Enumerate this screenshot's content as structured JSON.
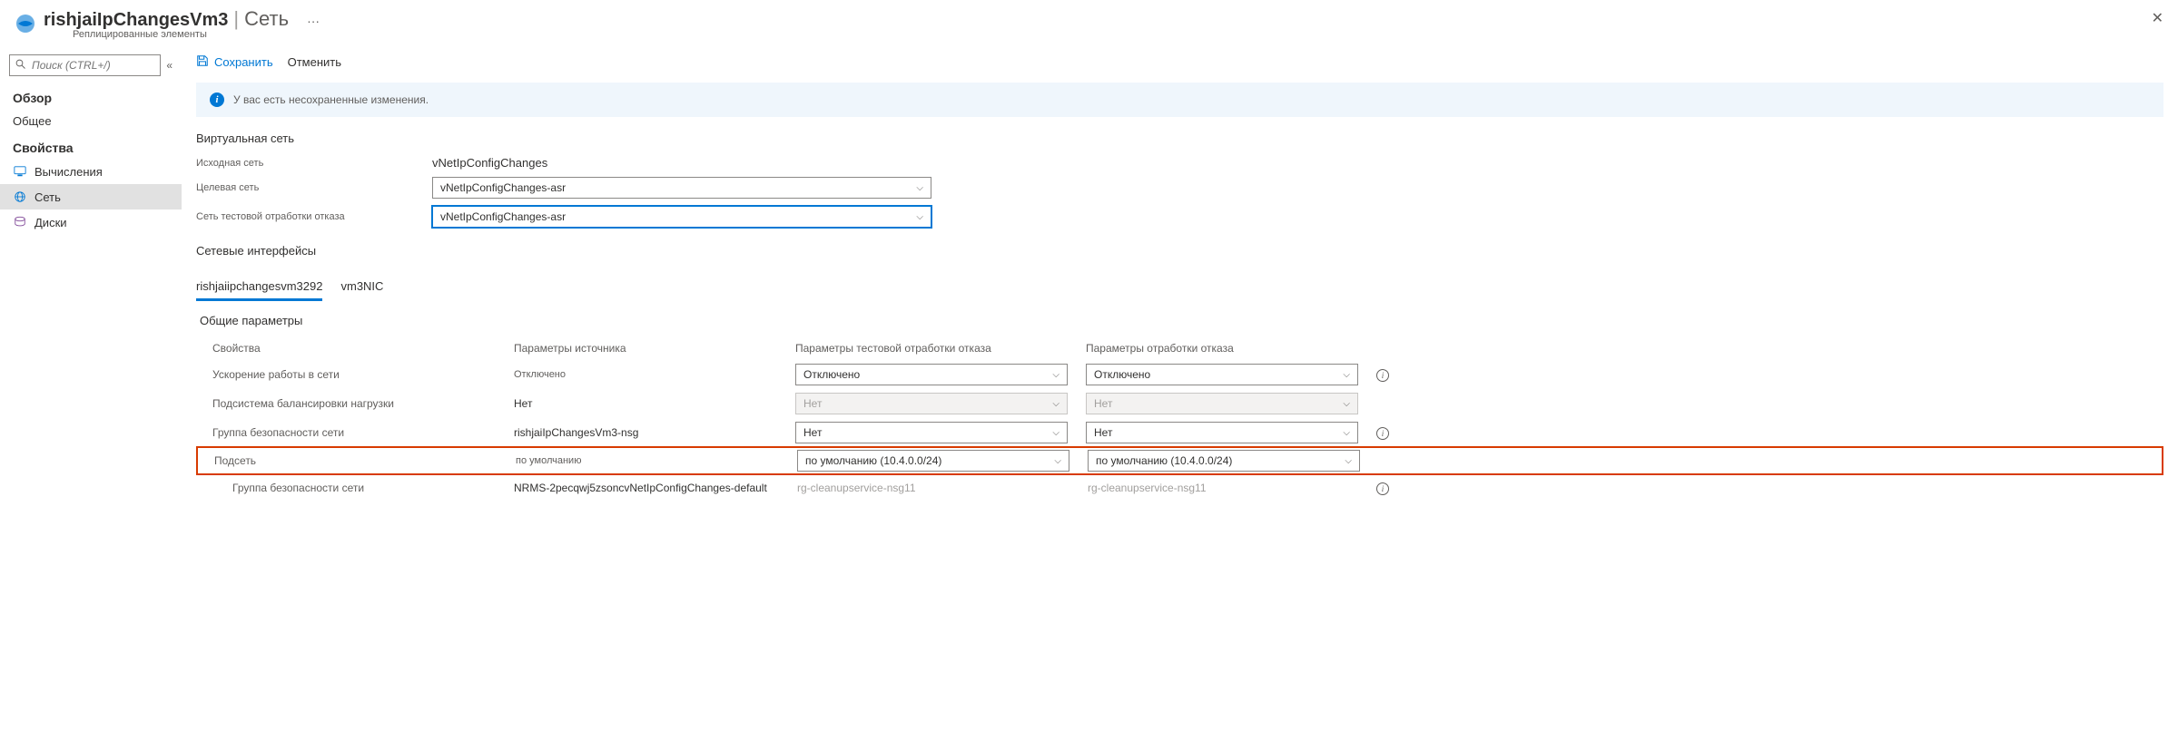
{
  "header": {
    "resource_name": "rishjaiIpChangesVm3",
    "blade_title": "Сеть",
    "subtitle": "Реплицированные элементы",
    "more": "···",
    "close": "✕"
  },
  "search": {
    "placeholder": "Поиск (CTRL+/)"
  },
  "nav": {
    "overview": "Обзор",
    "general": "Общее",
    "properties": "Свойства",
    "compute": "Вычисления",
    "network": "Сеть",
    "disks": "Диски"
  },
  "toolbar": {
    "save": "Сохранить",
    "cancel": "Отменить"
  },
  "banner": {
    "text": "У вас есть несохраненные изменения."
  },
  "vnet": {
    "section": "Виртуальная сеть",
    "source_label": "Исходная сеть",
    "source_value": "vNetIpConfigChanges",
    "target_label": "Целевая сеть",
    "target_value": "vNetIpConfigChanges-asr",
    "testfo_label": "Сеть тестовой отработки отказа",
    "testfo_value": "vNetIpConfigChanges-asr"
  },
  "nics": {
    "section": "Сетевые интерфейсы",
    "tab1": "rishjaiipchangesvm3292",
    "tab2": "vm3NIC"
  },
  "general": {
    "section": "Общие параметры",
    "col_prop": "Свойства",
    "col_src": "Параметры источника",
    "col_test": "Параметры тестовой отработки отказа",
    "col_fail": "Параметры отработки отказа",
    "rows": {
      "accel_label": "Ускорение работы в сети",
      "accel_src": "Отключено",
      "accel_test": "Отключено",
      "accel_fail": "Отключено",
      "lb_label": "Подсистема балансировки нагрузки",
      "lb_src": "Нет",
      "lb_test": "Нет",
      "lb_fail": "Нет",
      "nsg_label": "Группа безопасности сети",
      "nsg_src": "rishjaiIpChangesVm3-nsg",
      "nsg_test": "Нет",
      "nsg_fail": "Нет",
      "subnet_label": "Подсеть",
      "subnet_src": "по умолчанию",
      "subnet_test": "по умолчанию (10.4.0.0/24)",
      "subnet_fail": "по умолчанию (10.4.0.0/24)",
      "nsg2_label": "Группа безопасности сети",
      "nsg2_src": "NRMS-2pecqwj5zsoncvNetIpConfigChanges-default",
      "nsg2_test": "rg-cleanupservice-nsg11",
      "nsg2_fail": "rg-cleanupservice-nsg11"
    }
  }
}
